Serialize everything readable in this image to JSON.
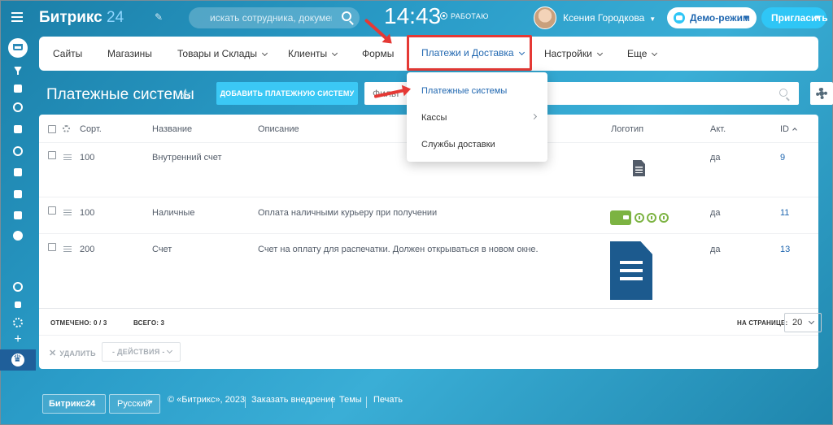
{
  "header": {
    "logo_text": "Битрикс",
    "logo_number": "24",
    "search_placeholder": "искать сотрудника, документ, про...",
    "clock": "14:43",
    "work_status": "РАБОТАЮ",
    "user_name": "Ксения Городкова",
    "demo_label": "Демо-режим",
    "invite_label": "Пригласить"
  },
  "nav": {
    "items": [
      {
        "label": "Сайты"
      },
      {
        "label": "Магазины"
      },
      {
        "label": "Товары и Склады"
      },
      {
        "label": "Клиенты"
      },
      {
        "label": "Формы"
      },
      {
        "label": "Платежи и Доставка"
      },
      {
        "label": "Настройки"
      },
      {
        "label": "Еще"
      }
    ]
  },
  "dropdown": {
    "items": [
      {
        "label": "Платежные системы"
      },
      {
        "label": "Кассы"
      },
      {
        "label": "Службы доставки"
      }
    ]
  },
  "page": {
    "title": "Платежные системы",
    "add_button": "ДОБАВИТЬ ПЛАТЕЖНУЮ СИСТЕМУ",
    "filter_placeholder": "Фильт"
  },
  "grid": {
    "columns": {
      "sort": "Сорт.",
      "name": "Название",
      "description": "Описание",
      "logo": "Логотип",
      "active": "Акт.",
      "id": "ID"
    },
    "rows": [
      {
        "sort": "100",
        "name": "Внутренний счет",
        "description": "",
        "active": "да",
        "id": "9",
        "logo_icon": "document-icon"
      },
      {
        "sort": "100",
        "name": "Наличные",
        "description": "Оплата наличными курьеру при получении",
        "active": "да",
        "id": "11",
        "logo_icon": "wallet-icon"
      },
      {
        "sort": "200",
        "name": "Счет",
        "description": "Счет на оплату для распечатки. Должен открываться в новом окне.",
        "active": "да",
        "id": "13",
        "logo_icon": "invoice-icon"
      }
    ],
    "selected_label": "ОТМЕЧЕНО: 0 / 3",
    "total_label": "ВСЕГО: 3",
    "per_page_label": "НА СТРАНИЦЕ:",
    "per_page_value": "20",
    "delete_label": "УДАЛИТЬ",
    "actions_label": "- ДЕЙСТВИЯ -"
  },
  "footer": {
    "logo": "Битрикс24",
    "language": "Русский",
    "copyright": "© «Битрикс», 2023",
    "order_link": "Заказать внедрение",
    "themes_link": "Темы",
    "print_link": "Печать"
  },
  "colors": {
    "accent": "#2067b0",
    "button": "#3bc8f5",
    "highlight": "#e53935",
    "logo_green": "#7cb342",
    "logo_blue": "#1c5a8e"
  }
}
